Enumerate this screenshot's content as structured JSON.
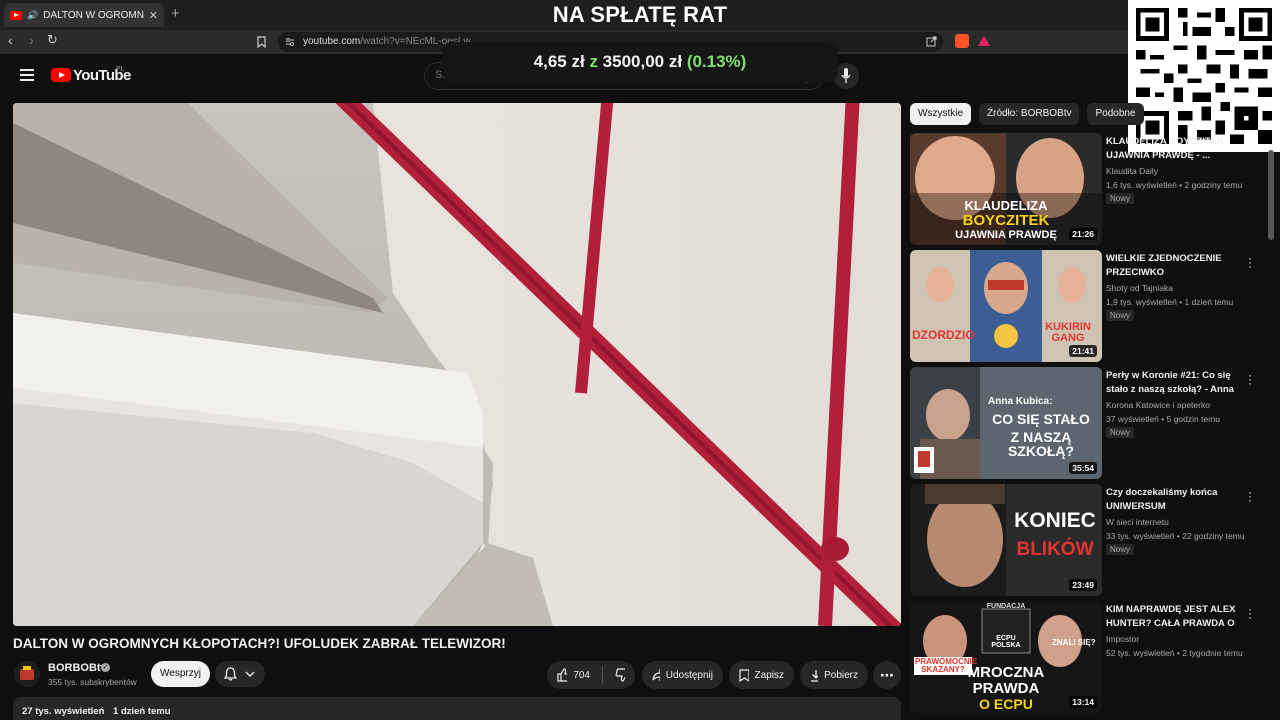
{
  "browser": {
    "tab_title": "DALTON W OGROMNYCH KŁ",
    "url_host": "youtube.com",
    "url_path": "/watch?v=NEcML-oesLw"
  },
  "overlay": {
    "title": "NA SPŁATĘ RAT",
    "current": "4,65 zł",
    "connector": "z",
    "goal": "3500,00 zł",
    "percent": "(0.13%)",
    "progress_fraction": 0.0013
  },
  "youtube": {
    "logo": "YouTube",
    "country": "PL",
    "search_placeholder": "Szukaj"
  },
  "video": {
    "title": "DALTON W OGROMNYCH KŁOPOTACH?! UFOLUDEK ZABRAŁ TELEWIZOR!",
    "channel": "BORBOBtv",
    "subscribers": "355 tys. subskrybentów",
    "support_label": "Wesprzyj",
    "likes": "704",
    "share_label": "Udostępnij",
    "save_label": "Zapisz",
    "download_label": "Pobierz",
    "views": "27 tys. wyświetleń",
    "age": "1 dzień temu"
  },
  "chips": [
    "Wszystkie",
    "Źródło: BORBOBtv",
    "Podobne"
  ],
  "recommendations": [
    {
      "title": "KLAUDELIZA BOYCZITEK UJAWNIA PRAWDĘ - ...",
      "channel": "Klaudita Daily",
      "meta": "1,6 tys. wyświetleń • 2 godziny temu",
      "badge": "Nowy",
      "duration": "21:26",
      "thumb_lines": [
        "KLAUDELIZA",
        "BOYCZITEK",
        "UJAWNIA PRAWDĘ"
      ]
    },
    {
      "title": "WIELKIE ZJEDNOCZENIE PRZECIWKO DZIELNICOWEJ | ...",
      "channel": "Shoty od Tajniaka",
      "meta": "1,9 tys. wyświetleń • 1 dzień temu",
      "badge": "Nowy",
      "duration": "21:41",
      "thumb_lines": [
        "DZORDZIO",
        "KUKIRIN GANG"
      ]
    },
    {
      "title": "Perły w Koronie #21: Co się stało z naszą szkołą? - Anna ...",
      "channel": "Korona Katowice i apeterko",
      "meta": "37 wyświetleń • 5 godzin temu",
      "badge": "Nowy",
      "duration": "35:54",
      "thumb_lines": [
        "Anna Kubica:",
        "CO SIĘ STAŁO",
        "Z NASZĄ SZKOŁĄ?"
      ]
    },
    {
      "title": "Czy doczekaliśmy końca UNIWERSUM KŁOSOWSKICH?",
      "channel": "W sieci internetu",
      "meta": "33 tys. wyświetleń • 22 godziny temu",
      "badge": "Nowy",
      "duration": "23:49",
      "thumb_lines": [
        "KONIEC",
        "BLIKÓW"
      ]
    },
    {
      "title": "KIM NAPRAWDĘ JEST ALEX HUNTER? CAŁA PRAWDA O ...",
      "channel": "Impostor",
      "meta": "52 tys. wyświetleń • 2 tygodnie temu",
      "badge": "",
      "duration": "13:14",
      "thumb_lines": [
        "MROCZNA",
        "PRAWDA",
        "O ECPU",
        "PRAWOMOCNIE SKAZANY?",
        "ZNALI SIĘ?",
        "FUNDACJA",
        "ECPU POLSKA"
      ]
    }
  ]
}
